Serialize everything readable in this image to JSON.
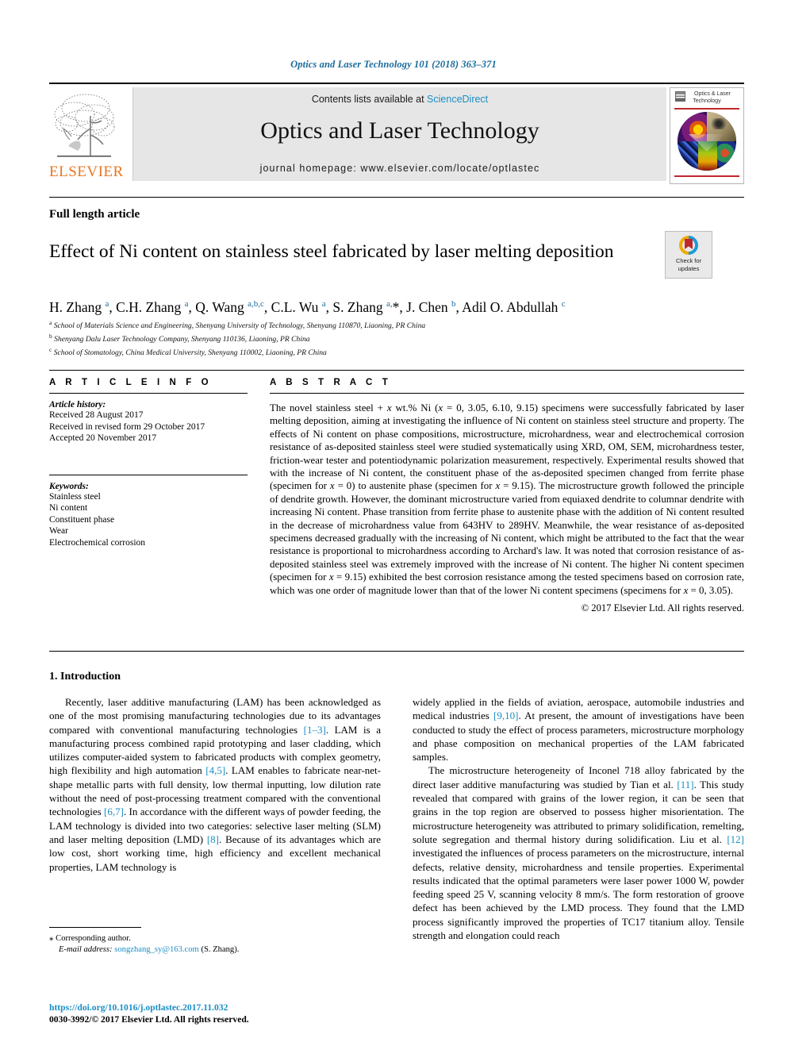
{
  "running_head": "Optics and Laser Technology 101 (2018) 363–371",
  "masthead": {
    "publisher_name": "ELSEVIER",
    "contents_prefix": "Contents lists available at ",
    "sciencedirect": "ScienceDirect",
    "journal_title": "Optics and Laser Technology",
    "homepage": "journal homepage: www.elsevier.com/locate/optlastec",
    "cover_title_line1": "Optics & Laser",
    "cover_title_line2": "Technology"
  },
  "article": {
    "type": "Full length article",
    "title": "Effect of Ni content on stainless steel fabricated by laser melting deposition",
    "crossmark_line1": "Check for",
    "crossmark_line2": "updates",
    "authors": "H. Zhang a, C.H. Zhang a, Q. Wang a,b,c, C.L. Wu a, S. Zhang a,*, J. Chen b, Adil O. Abdullah c",
    "affiliations": [
      "a School of Materials Science and Engineering, Shenyang University of Technology, Shenyang 110870, Liaoning, PR China",
      "b Shenyang Dalu Laser Technology Company, Shenyang 110136, Liaoning, PR China",
      "c School of Stomatology, China Medical University, Shenyang 110002, Liaoning, PR China"
    ]
  },
  "article_info": {
    "heading": "A R T I C L E   I N F O",
    "history_label": "Article history:",
    "history": [
      "Received 28 August 2017",
      "Received in revised form 29 October 2017",
      "Accepted 20 November 2017"
    ],
    "keywords_label": "Keywords:",
    "keywords": [
      "Stainless steel",
      "Ni content",
      "Constituent phase",
      "Wear",
      "Electrochemical corrosion"
    ]
  },
  "abstract": {
    "heading": "A B S T R A C T",
    "text": "The novel stainless steel + x wt.% Ni (x = 0, 3.05, 6.10, 9.15) specimens were successfully fabricated by laser melting deposition, aiming at investigating the influence of Ni content on stainless steel structure and property. The effects of Ni content on phase compositions, microstructure, microhardness, wear and electrochemical corrosion resistance of as-deposited stainless steel were studied systematically using XRD, OM, SEM, microhardness tester, friction-wear tester and potentiodynamic polarization measurement, respectively. Experimental results showed that with the increase of Ni content, the constituent phase of the as-deposited specimen changed from ferrite phase (specimen for x = 0) to austenite phase (specimen for x = 9.15). The microstructure growth followed the principle of dendrite growth. However, the dominant microstructure varied from equiaxed dendrite to columnar dendrite with increasing Ni content. Phase transition from ferrite phase to austenite phase with the addition of Ni content resulted in the decrease of microhardness value from 643HV to 289HV. Meanwhile, the wear resistance of as-deposited specimens decreased gradually with the increasing of Ni content, which might be attributed to the fact that the wear resistance is proportional to microhardness according to Archard's law. It was noted that corrosion resistance of as-deposited stainless steel was extremely improved with the increase of Ni content. The higher Ni content specimen (specimen for x = 9.15) exhibited the best corrosion resistance among the tested specimens based on corrosion rate, which was one order of magnitude lower than that of the lower Ni content specimens (specimens for x = 0, 3.05).",
    "copyright": "© 2017 Elsevier Ltd. All rights reserved."
  },
  "introduction": {
    "heading": "1. Introduction",
    "left_paragraph": "Recently, laser additive manufacturing (LAM) has been acknowledged as one of the most promising manufacturing technologies due to its advantages compared with conventional manufacturing technologies [1–3]. LAM is a manufacturing process combined rapid prototyping and laser cladding, which utilizes computer-aided system to fabricated products with complex geometry, high flexibility and high automation [4,5]. LAM enables to fabricate near-net-shape metallic parts with full density, low thermal inputting, low dilution rate without the need of post-processing treatment compared with the conventional technologies [6,7]. In accordance with the different ways of powder feeding, the LAM technology is divided into two categories: selective laser melting (SLM) and laser melting deposition (LMD) [8]. Because of its advantages which are low cost, short working time, high efficiency and excellent mechanical properties, LAM technology is",
    "right_paragraph_1": "widely applied in the fields of aviation, aerospace, automobile industries and medical industries [9,10]. At present, the amount of investigations have been conducted to study the effect of process parameters, microstructure morphology and phase composition on mechanical properties of the LAM fabricated samples.",
    "right_paragraph_2": "The microstructure heterogeneity of Inconel 718 alloy fabricated by the direct laser additive manufacturing was studied by Tian et al. [11]. This study revealed that compared with grains of the lower region, it can be seen that grains in the top region are observed to possess higher misorientation. The microstructure heterogeneity was attributed to primary solidification, remelting, solute segregation and thermal history during solidification. Liu et al. [12] investigated the influences of process parameters on the microstructure, internal defects, relative density, microhardness and tensile properties. Experimental results indicated that the optimal parameters were laser power 1000 W, powder feeding speed 25 V, scanning velocity 8 mm/s. The form restoration of groove defect has been achieved by the LMD process. They found that the LMD process significantly improved the properties of TC17 titanium alloy. Tensile strength and elongation could reach"
  },
  "footnote": {
    "corresponding": "Corresponding author.",
    "email_label": "E-mail address:",
    "email": "songzhang_sy@163.com",
    "email_owner": "(S. Zhang)."
  },
  "footer": {
    "doi": "https://doi.org/10.1016/j.optlastec.2017.11.032",
    "issn_line": "0030-3992/© 2017 Elsevier Ltd. All rights reserved."
  },
  "colors": {
    "link": "#1a8ec4",
    "running_head": "#1a6b9a",
    "elsevier_orange": "#E87722",
    "banner_bg": "#e6e6e6"
  }
}
